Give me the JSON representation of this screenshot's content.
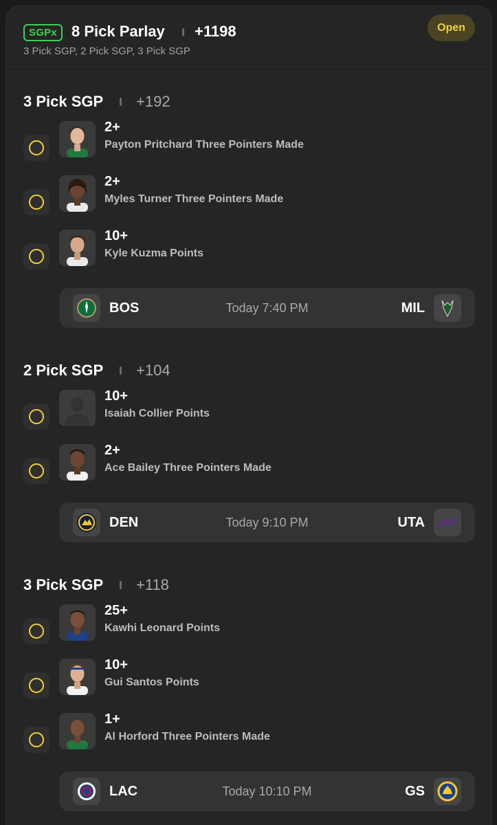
{
  "parlay": {
    "badge": "SGPx",
    "title": "8 Pick Parlay",
    "odds": "+1198",
    "subtitle": "3 Pick SGP, 2 Pick SGP, 3 Pick SGP",
    "status": "Open"
  },
  "sections": [
    {
      "title": "3 Pick SGP",
      "odds": "+192",
      "picks": [
        {
          "line": "2+",
          "desc": "Payton Pritchard Three Pointers Made"
        },
        {
          "line": "2+",
          "desc": "Myles Turner Three Pointers Made"
        },
        {
          "line": "10+",
          "desc": "Kyle Kuzma Points"
        }
      ],
      "game": {
        "home": "BOS",
        "away": "MIL",
        "time": "Today 7:40 PM",
        "home_logo": "celtics-logo-icon",
        "away_logo": "bucks-logo-icon"
      }
    },
    {
      "title": "2 Pick SGP",
      "odds": "+104",
      "picks": [
        {
          "line": "10+",
          "desc": "Isaiah Collier Points"
        },
        {
          "line": "2+",
          "desc": "Ace Bailey Three Pointers Made"
        }
      ],
      "game": {
        "home": "DEN",
        "away": "UTA",
        "time": "Today 9:10 PM",
        "home_logo": "nuggets-logo-icon",
        "away_logo": "jazz-logo-icon"
      }
    },
    {
      "title": "3 Pick SGP",
      "odds": "+118",
      "picks": [
        {
          "line": "25+",
          "desc": "Kawhi Leonard Points"
        },
        {
          "line": "10+",
          "desc": "Gui Santos Points"
        },
        {
          "line": "1+",
          "desc": "Al Horford Three Pointers Made"
        }
      ],
      "game": {
        "home": "LAC",
        "away": "GS",
        "time": "Today 10:10 PM",
        "home_logo": "clippers-logo-icon",
        "away_logo": "warriors-logo-icon"
      }
    }
  ],
  "colors": {
    "accent_yellow": "#f5d232",
    "sgpx_green": "#3fcf4f",
    "card_bg": "#252525"
  }
}
